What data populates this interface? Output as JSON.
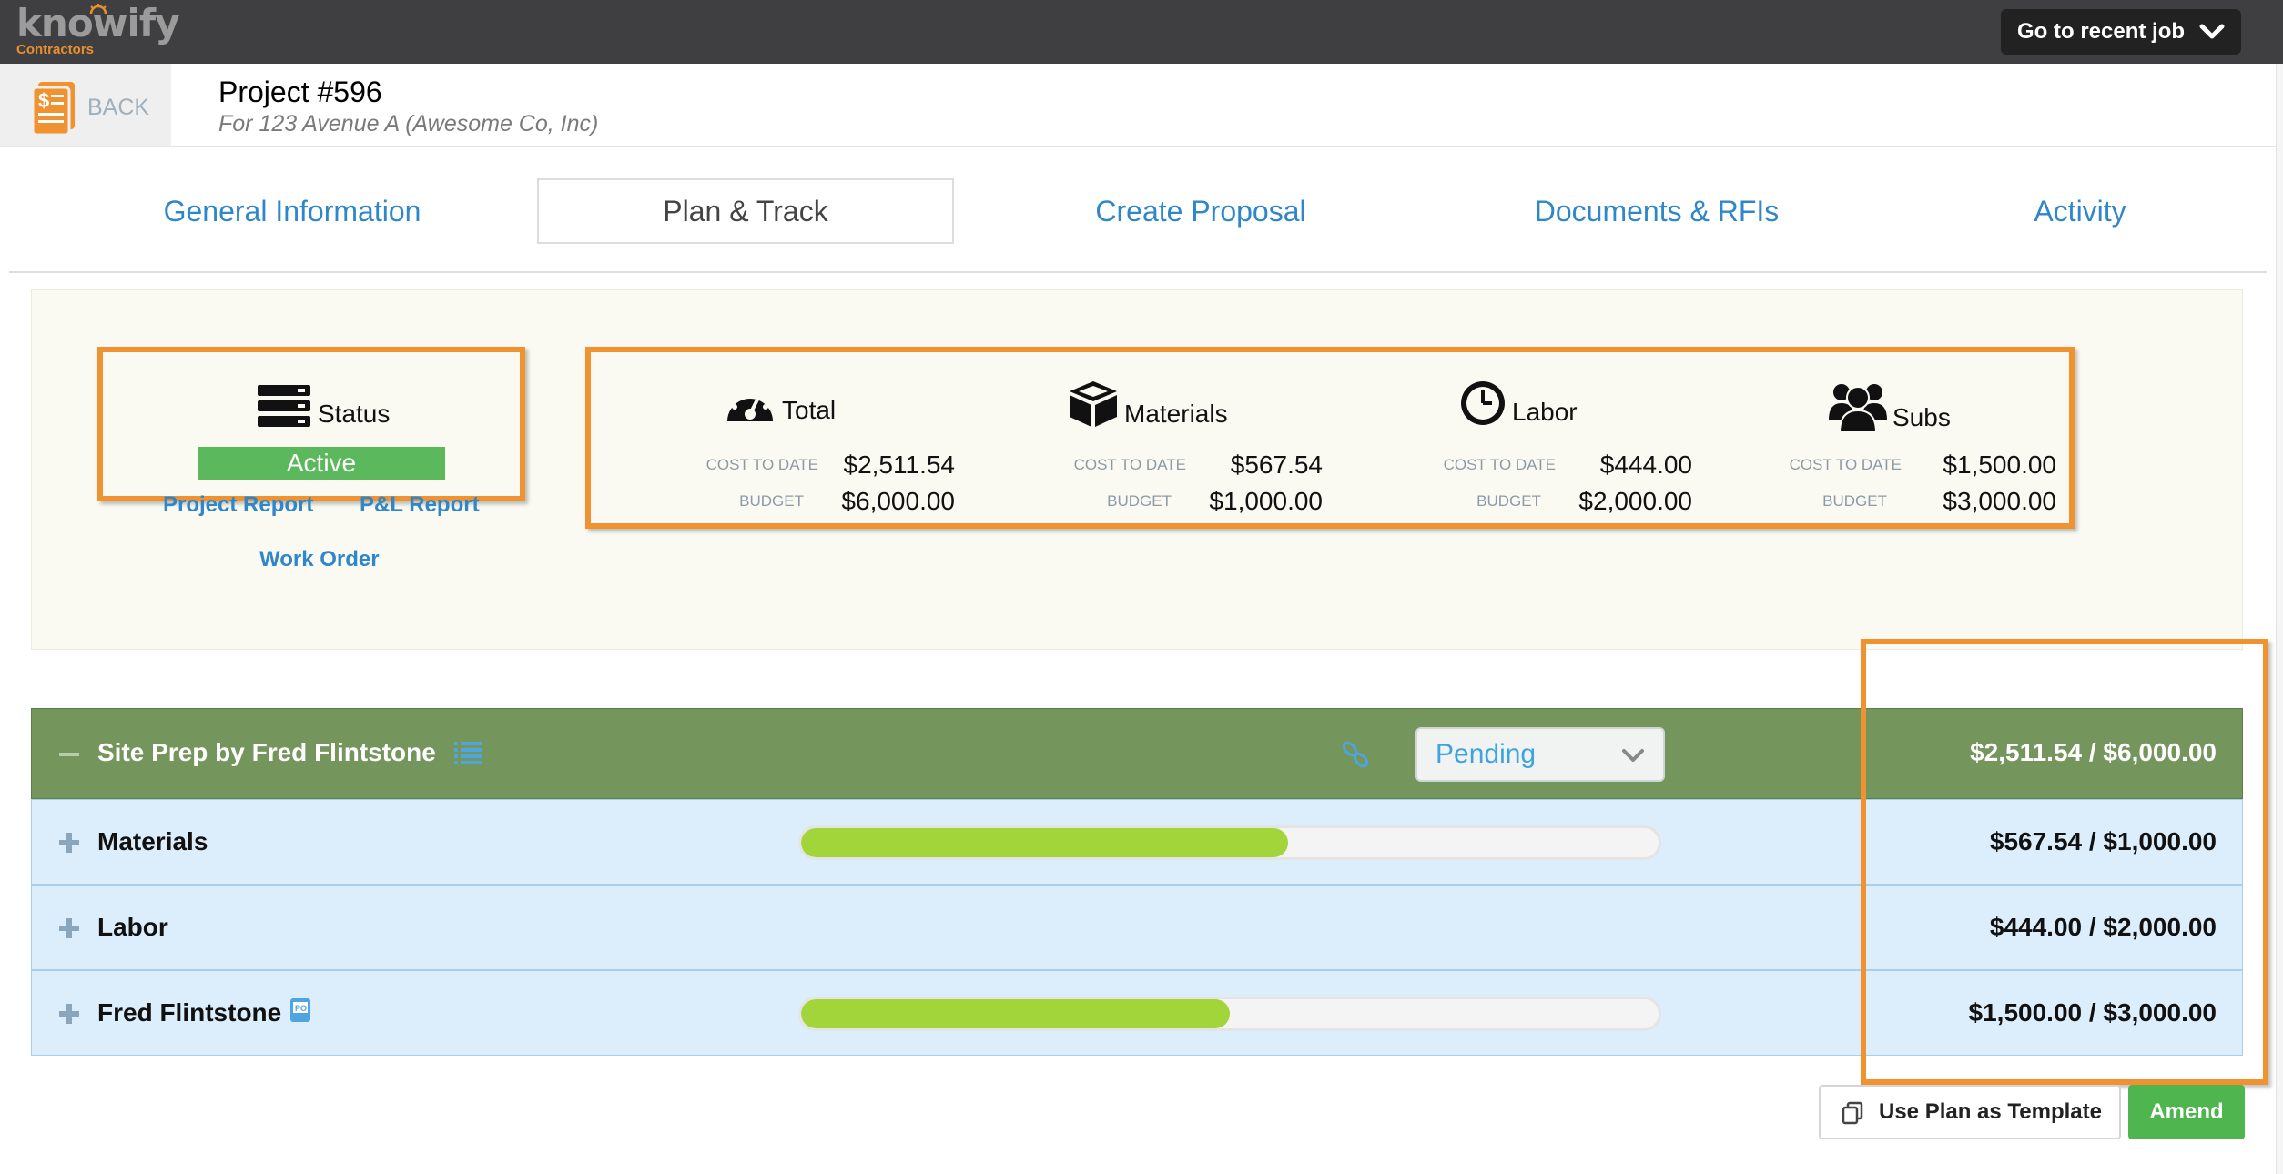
{
  "app": {
    "logo_text": "knowify",
    "logo_sub": "Contractors",
    "recent_job_label": "Go to recent job"
  },
  "header": {
    "back_label": "BACK",
    "project_title": "Project #596",
    "project_subtitle": "For 123 Avenue A (Awesome Co, Inc)"
  },
  "tabs": [
    {
      "label": "General Information",
      "active": false
    },
    {
      "label": "Plan & Track",
      "active": true
    },
    {
      "label": "Create Proposal",
      "active": false
    },
    {
      "label": "Documents & RFIs",
      "active": false
    },
    {
      "label": "Activity",
      "active": false
    }
  ],
  "status": {
    "label": "Status",
    "value": "Active",
    "value_color": "#5cb85c",
    "links": {
      "project_report": "Project Report",
      "pl_report": "P&L Report",
      "work_order": "Work Order"
    }
  },
  "costs": {
    "cost_to_date_label": "COST TO DATE",
    "budget_label": "BUDGET",
    "columns": [
      {
        "label": "Total",
        "icon": "dashboard-icon",
        "cost_to_date": "$2,511.54",
        "budget": "$6,000.00"
      },
      {
        "label": "Materials",
        "icon": "box-icon",
        "cost_to_date": "$567.54",
        "budget": "$1,000.00"
      },
      {
        "label": "Labor",
        "icon": "clock-icon",
        "cost_to_date": "$444.00",
        "budget": "$2,000.00"
      },
      {
        "label": "Subs",
        "icon": "users-icon",
        "cost_to_date": "$1,500.00",
        "budget": "$3,000.00"
      }
    ]
  },
  "plan": {
    "phase": {
      "title": "Site Prep by Fred Flintstone",
      "status": "Pending",
      "amount": "$2,511.54 / $6,000.00"
    },
    "items": [
      {
        "name": "Materials",
        "amount": "$567.54 / $1,000.00",
        "progress": 0.5675,
        "has_progress": true
      },
      {
        "name": "Labor",
        "amount": "$444.00 / $2,000.00",
        "has_progress": false
      },
      {
        "name": "Fred Flintstone",
        "amount": "$1,500.00 / $3,000.00",
        "progress": 0.5,
        "has_progress": true,
        "icon": "po-icon"
      }
    ]
  },
  "actions": {
    "use_template_label": "Use Plan as Template",
    "amend_label": "Amend"
  },
  "colors": {
    "accent_blue": "#2f86c8",
    "highlight_orange": "#f0922f",
    "phase_green": "#74965d",
    "amend_green": "#4fb54f",
    "progress_green": "#a1d53a"
  }
}
